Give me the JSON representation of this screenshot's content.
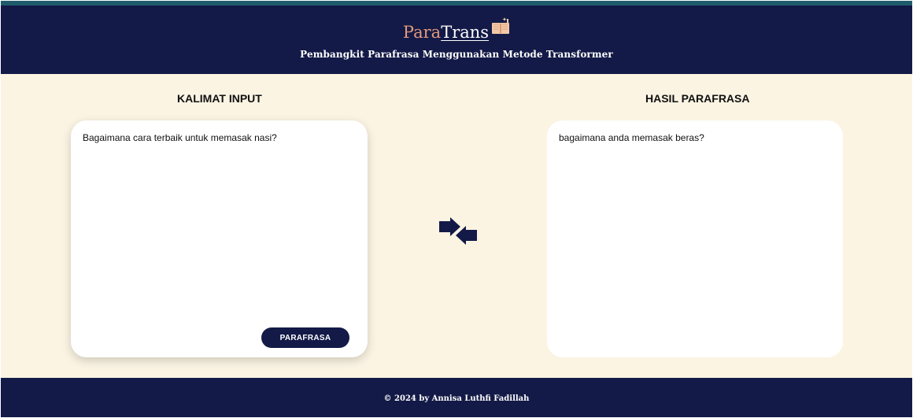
{
  "header": {
    "logo_part1": "Para",
    "logo_part2": "Trans",
    "logo_icon": "open-book-icon",
    "subtitle": "Pembangkit Parafrasa Menggunakan Metode Transformer"
  },
  "input_section": {
    "label": "KALIMAT INPUT",
    "text": "Bagaimana cara terbaik untuk memasak nasi?",
    "button_label": "PARAFRASA"
  },
  "output_section": {
    "label": "HASIL PARAFRASA",
    "text": "bagaimana anda memasak beras?"
  },
  "swap_icon": "swap-arrows-icon",
  "footer": {
    "copyright": "© 2024 by Annisa Luthfi Fadillah"
  },
  "colors": {
    "navy": "#131a47",
    "cream": "#fbf4e3",
    "accent": "#e39a7b",
    "teal_line": "#1f5c6b"
  }
}
